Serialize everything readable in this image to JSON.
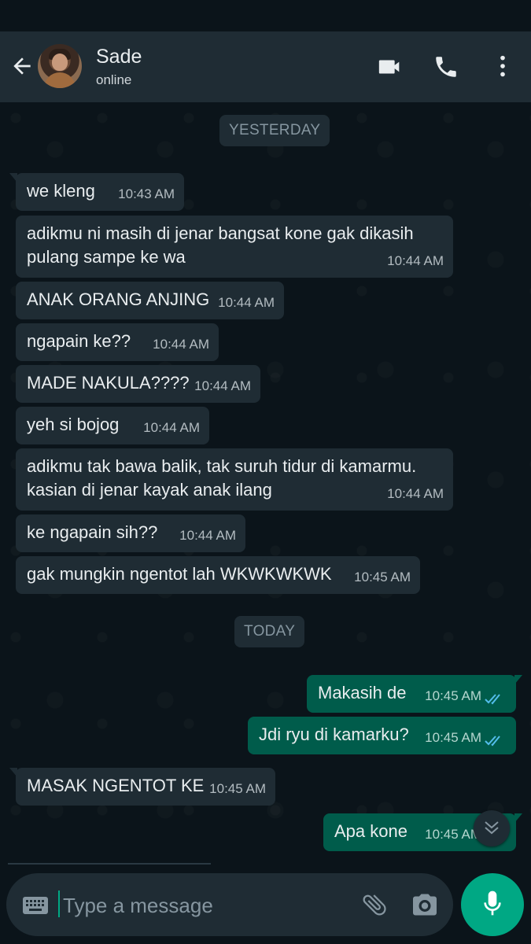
{
  "header": {
    "contact_name": "Sade",
    "contact_status": "online",
    "icons": [
      "back-arrow-icon",
      "avatar",
      "video-call-icon",
      "voice-call-icon",
      "more-options-icon"
    ]
  },
  "chat": {
    "day_yesterday": "YESTERDAY",
    "day_today": "TODAY",
    "messages": [
      {
        "dir": "in",
        "text": "we kleng",
        "time": "10:43 AM"
      },
      {
        "dir": "in",
        "text_lines": [
          "adikmu ni masih di jenar bangsat kone gak dikasih",
          "pulang sampe ke wa"
        ],
        "time": "10:44 AM"
      },
      {
        "dir": "in",
        "text": "ANAK ORANG ANJING",
        "time": "10:44 AM"
      },
      {
        "dir": "in",
        "text": "ngapain ke??",
        "time": "10:44 AM"
      },
      {
        "dir": "in",
        "text": "MADE NAKULA????",
        "time": "10:44 AM"
      },
      {
        "dir": "in",
        "text": "yeh si bojog",
        "time": "10:44 AM"
      },
      {
        "dir": "in",
        "text_lines": [
          "adikmu tak bawa balik, tak suruh tidur di kamarmu.",
          "kasian di jenar kayak anak ilang"
        ],
        "time": "10:44 AM"
      },
      {
        "dir": "in",
        "text": "ke ngapain sih??",
        "time": "10:44 AM"
      },
      {
        "dir": "in",
        "text": "gak mungkin ngentot lah WKWKWKWK",
        "time": "10:45 AM"
      },
      {
        "dir": "out",
        "text": "Makasih de",
        "time": "10:45 AM",
        "status": "read"
      },
      {
        "dir": "out",
        "text": "Jdi ryu di kamarku?",
        "time": "10:45 AM",
        "status": "read"
      },
      {
        "dir": "in",
        "text": "MASAK NGENTOT KE",
        "time": "10:45 AM"
      },
      {
        "dir": "out",
        "text": "Apa kone",
        "time": "10:45 AM"
      }
    ]
  },
  "composer": {
    "placeholder": "Type a message"
  },
  "colors": {
    "background": "#0b141a",
    "header": "#1f2c34",
    "incoming_bubble": "#1f2c34",
    "outgoing_bubble": "#005c4b",
    "accent": "#00a884",
    "read_tick": "#53bdeb"
  }
}
